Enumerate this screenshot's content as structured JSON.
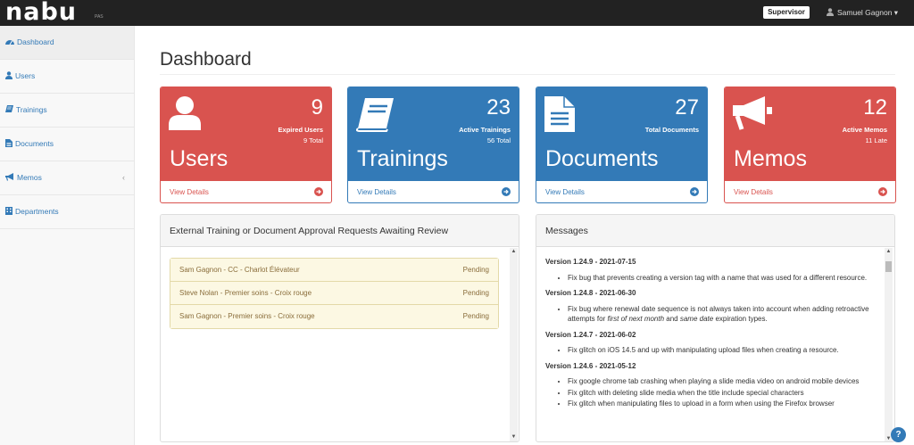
{
  "app": {
    "logo": "nabu",
    "logo_sub": "PAS"
  },
  "header": {
    "role_badge": "Supervisor",
    "user_name": "Samuel Gagnon ▾"
  },
  "sidebar": {
    "items": [
      {
        "label": "Dashboard",
        "icon": "dashboard-icon"
      },
      {
        "label": "Users",
        "icon": "user-icon"
      },
      {
        "label": "Trainings",
        "icon": "book-icon"
      },
      {
        "label": "Documents",
        "icon": "document-icon"
      },
      {
        "label": "Memos",
        "icon": "bullhorn-icon",
        "chevron": "‹"
      },
      {
        "label": "Departments",
        "icon": "building-icon"
      }
    ]
  },
  "page": {
    "title": "Dashboard"
  },
  "cards": [
    {
      "name": "Users",
      "count": "9",
      "sub1": "Expired Users",
      "sub2": "9 Total",
      "link": "View Details",
      "color": "#d9534f",
      "icon": "user-icon"
    },
    {
      "name": "Trainings",
      "count": "23",
      "sub1": "Active Trainings",
      "sub2": "56 Total",
      "link": "View Details",
      "color": "#337ab7",
      "icon": "book-icon"
    },
    {
      "name": "Documents",
      "count": "27",
      "sub1": "Total Documents",
      "sub2": "",
      "link": "View Details",
      "color": "#337ab7",
      "icon": "document-icon"
    },
    {
      "name": "Memos",
      "count": "12",
      "sub1": "Active Memos",
      "sub2": "11 Late",
      "link": "View Details",
      "color": "#d9534f",
      "icon": "bullhorn-icon"
    }
  ],
  "requests_panel": {
    "title": "External Training or Document Approval Requests Awaiting Review",
    "rows": [
      {
        "name": "Sam Gagnon - CC - Charlot Élévateur",
        "status": "Pending"
      },
      {
        "name": "Steve Nolan - Premier soins - Croix rouge",
        "status": "Pending"
      },
      {
        "name": "Sam Gagnon - Premier soins - Croix rouge",
        "status": "Pending"
      }
    ]
  },
  "messages_panel": {
    "title": "Messages",
    "v1": {
      "title": "Version 1.24.9 - 2021-07-15",
      "i1": "Fix bug that prevents creating a version tag with a name that was used for a different resource."
    },
    "v2": {
      "title": "Version 1.24.8 - 2021-06-30",
      "i1a": "Fix bug where renewal date sequence is not always taken into account when adding retroactive attempts for ",
      "i1b": "first of next month",
      "i1c": " and ",
      "i1d": "same date",
      "i1e": " expiration types."
    },
    "v3": {
      "title": "Version 1.24.7 - 2021-06-02",
      "i1": "Fix glitch on iOS 14.5 and up with manipulating upload files when creating a resource."
    },
    "v4": {
      "title": "Version 1.24.6 - 2021-05-12",
      "i1": "Fix google chrome tab crashing when playing a slide media video on android mobile devices",
      "i2": "Fix glitch with deleting slide media when the title include special characters",
      "i3": "Fix glitch when manipulating files to upload in a form when using the Firefox browser"
    }
  },
  "help": {
    "label": "?"
  }
}
